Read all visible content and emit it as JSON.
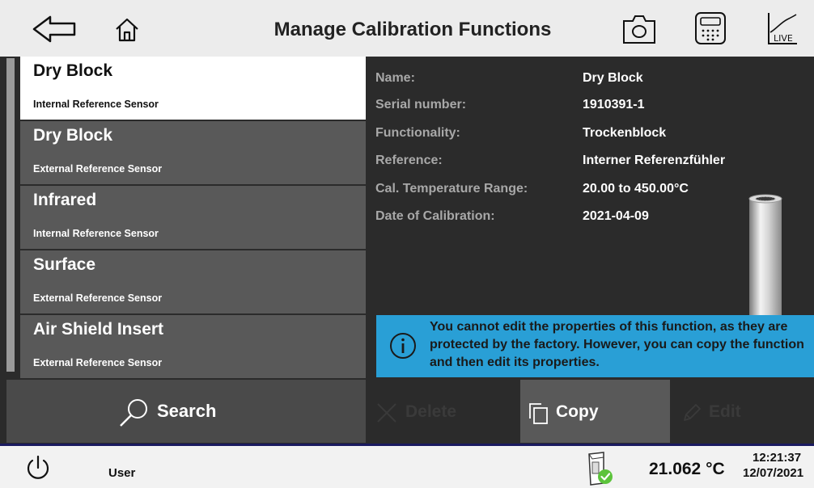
{
  "header": {
    "title": "Manage Calibration Functions",
    "live_label": "LIVE"
  },
  "list": {
    "items": [
      {
        "name": "Dry Block",
        "sub": "Internal Reference Sensor",
        "selected": true
      },
      {
        "name": "Dry Block",
        "sub": "External Reference Sensor",
        "selected": false
      },
      {
        "name": "Infrared",
        "sub": "Internal Reference Sensor",
        "selected": false
      },
      {
        "name": "Surface",
        "sub": "External Reference Sensor",
        "selected": false
      },
      {
        "name": "Air Shield Insert",
        "sub": "External Reference Sensor",
        "selected": false
      }
    ]
  },
  "details": {
    "rows": [
      {
        "label": "Name:",
        "value": "Dry Block"
      },
      {
        "label": "Serial number:",
        "value": "1910391-1"
      },
      {
        "label": "Functionality:",
        "value": "Trockenblock"
      },
      {
        "label": "Reference:",
        "value": "Interner Referenzfühler"
      },
      {
        "label": "Cal. Temperature Range:",
        "value": "20.00 to 450.00°C"
      },
      {
        "label": "Date of Calibration:",
        "value": "2021-04-09"
      }
    ]
  },
  "info": {
    "message": "You cannot edit the properties of this function, as they are protected by the factory. However, you can copy the function and then edit its properties."
  },
  "actions": {
    "search_label": "Search",
    "delete_label": "Delete",
    "copy_label": "Copy",
    "edit_label": "Edit"
  },
  "status": {
    "user_label": "User",
    "temperature": "21.062 °C",
    "time": "12:21:37",
    "date": "12/07/2021"
  },
  "colors": {
    "info_bg": "#299fd6",
    "status_ok": "#5cc33b",
    "selected_bg": "#ffffff",
    "item_bg": "#595959"
  }
}
